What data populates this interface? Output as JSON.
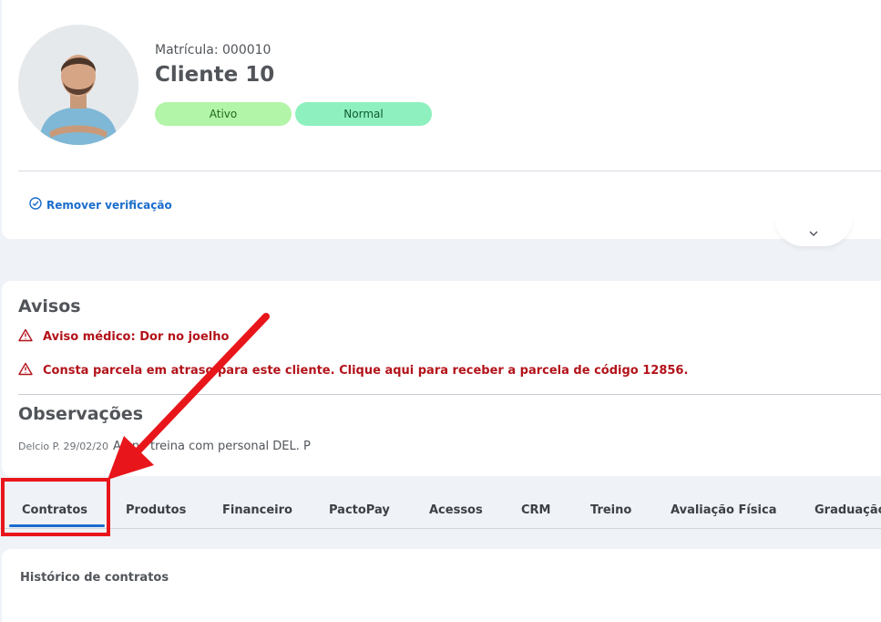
{
  "profile": {
    "matricula": "Matrícula: 000010",
    "name": "Cliente 10",
    "status_labels": [
      "Ativo",
      "Normal"
    ],
    "remove_verification": "Remover verificação"
  },
  "avisos": {
    "title": "Avisos",
    "items": [
      "Aviso médico: Dor no joelho",
      "Consta parcela em atraso para este cliente. Clique aqui para receber a parcela de código 12856."
    ]
  },
  "observacoes": {
    "title": "Observações",
    "meta": "Delcio P. 29/02/20",
    "text": "Aluno treina com personal DEL. P"
  },
  "tabs": [
    "Contratos",
    "Produtos",
    "Financeiro",
    "PactoPay",
    "Acessos",
    "CRM",
    "Treino",
    "Avaliação Física",
    "Graduação"
  ],
  "active_tab": "Contratos",
  "history": {
    "title": "Histórico de contratos"
  },
  "colors": {
    "accent": "#1a6dcc",
    "warning": "#b3131a",
    "status_ativo": "#b3f5a8",
    "status_normal": "#8ef0be",
    "annotation": "#e8161b"
  },
  "icons": {
    "verification": "check-circle-icon",
    "warning": "warning-triangle-icon",
    "expand": "chevron-down-icon"
  }
}
